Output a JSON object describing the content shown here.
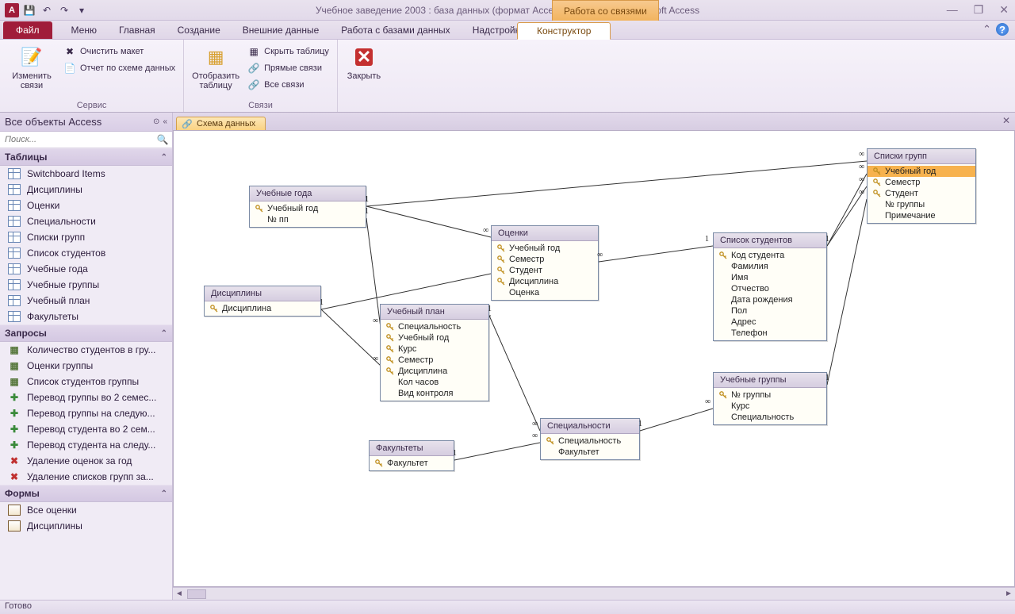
{
  "title": "Учебное заведение 2003 : база данных (формат Access 2002 - 2003)  -  Microsoft Access",
  "context_tool_label": "Работа со связями",
  "tabs": {
    "file": "Файл",
    "items": [
      "Меню",
      "Главная",
      "Создание",
      "Внешние данные",
      "Работа с базами данных",
      "Надстройки"
    ],
    "context": "Конструктор"
  },
  "ribbon": {
    "group1": {
      "label": "Сервис",
      "edit_relations": "Изменить связи",
      "clear_layout": "Очистить макет",
      "report": "Отчет по схеме данных"
    },
    "group2": {
      "show_table": "Отобразить таблицу",
      "hide_table": "Скрыть таблицу",
      "direct_rel": "Прямые связи",
      "all_rel": "Все связи",
      "label": "Связи"
    },
    "group3": {
      "close": "Закрыть"
    }
  },
  "nav": {
    "header": "Все объекты Access",
    "search_placeholder": "Поиск...",
    "groups": {
      "tables": {
        "label": "Таблицы",
        "items": [
          "Switchboard Items",
          "Дисциплины",
          "Оценки",
          "Специальности",
          "Списки групп",
          "Список студентов",
          "Учебные года",
          "Учебные группы",
          "Учебный план",
          "Факультеты"
        ]
      },
      "queries": {
        "label": "Запросы",
        "items": [
          "Количество студентов в гру...",
          "Оценки группы",
          "Список студентов группы",
          "Перевод группы во 2 семес...",
          "Перевод группы на следую...",
          "Перевод студента во 2 сем...",
          "Перевод студента на следу...",
          "Удаление оценок за год",
          "Удаление списков групп за..."
        ]
      },
      "forms": {
        "label": "Формы",
        "items": [
          "Все оценки",
          "Дисциплины"
        ]
      }
    }
  },
  "doc_tab": "Схема данных",
  "diagram": {
    "t_years": {
      "title": "Учебные года",
      "fields": [
        {
          "k": true,
          "n": "Учебный год"
        },
        {
          "k": false,
          "n": "№ пп"
        }
      ]
    },
    "t_disc": {
      "title": "Дисциплины",
      "fields": [
        {
          "k": true,
          "n": "Дисциплина"
        }
      ]
    },
    "t_grades": {
      "title": "Оценки",
      "fields": [
        {
          "k": true,
          "n": "Учебный год"
        },
        {
          "k": true,
          "n": "Семестр"
        },
        {
          "k": true,
          "n": "Студент"
        },
        {
          "k": true,
          "n": "Дисциплина"
        },
        {
          "k": false,
          "n": "Оценка"
        }
      ]
    },
    "t_plan": {
      "title": "Учебный план",
      "fields": [
        {
          "k": true,
          "n": "Специальность"
        },
        {
          "k": true,
          "n": "Учебный год"
        },
        {
          "k": true,
          "n": "Курс"
        },
        {
          "k": true,
          "n": "Семестр"
        },
        {
          "k": true,
          "n": "Дисциплина"
        },
        {
          "k": false,
          "n": "Кол часов"
        },
        {
          "k": false,
          "n": "Вид контроля"
        }
      ]
    },
    "t_fac": {
      "title": "Факультеты",
      "fields": [
        {
          "k": true,
          "n": "Факультет"
        }
      ]
    },
    "t_spec": {
      "title": "Специальности",
      "fields": [
        {
          "k": true,
          "n": "Специальность"
        },
        {
          "k": false,
          "n": "Факультет"
        }
      ]
    },
    "t_stud": {
      "title": "Список студентов",
      "fields": [
        {
          "k": true,
          "n": "Код студента"
        },
        {
          "k": false,
          "n": "Фамилия"
        },
        {
          "k": false,
          "n": "Имя"
        },
        {
          "k": false,
          "n": "Отчество"
        },
        {
          "k": false,
          "n": "Дата рождения"
        },
        {
          "k": false,
          "n": "Пол"
        },
        {
          "k": false,
          "n": "Адрес"
        },
        {
          "k": false,
          "n": "Телефон"
        }
      ]
    },
    "t_groups": {
      "title": "Учебные группы",
      "fields": [
        {
          "k": true,
          "n": "№ группы"
        },
        {
          "k": false,
          "n": "Курс"
        },
        {
          "k": false,
          "n": "Специальность"
        }
      ]
    },
    "t_lists": {
      "title": "Списки групп",
      "fields": [
        {
          "k": true,
          "n": "Учебный год",
          "sel": true
        },
        {
          "k": true,
          "n": "Семестр"
        },
        {
          "k": true,
          "n": "Студент"
        },
        {
          "k": false,
          "n": "№ группы"
        },
        {
          "k": false,
          "n": "Примечание"
        }
      ]
    }
  },
  "cardinality": {
    "one": "1",
    "many": "∞"
  },
  "status": "Готово"
}
